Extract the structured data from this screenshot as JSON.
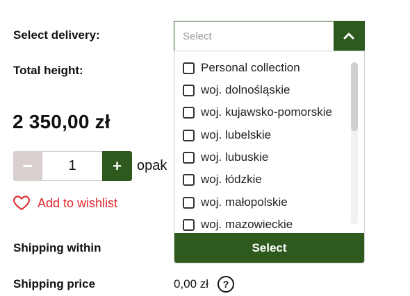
{
  "labels": {
    "select_delivery": "Select delivery:",
    "total_height": "Total height:",
    "shipping_within": "Shipping within",
    "shipping_price": "Shipping price"
  },
  "product": {
    "price": "2 350,00 zł"
  },
  "quantity": {
    "minus": "−",
    "value": "1",
    "plus": "+",
    "unit": "opak"
  },
  "wishlist": {
    "label": "Add to wishlist",
    "icon": "heart-icon",
    "color": "#e0252b"
  },
  "shipping": {
    "price": "0,00 zł",
    "help": "?"
  },
  "delivery_dropdown": {
    "placeholder": "Select",
    "toggle_icon": "chevron-up-icon",
    "options": [
      "Personal collection",
      "woj. dolnośląskie",
      "woj. kujawsko-pomorskie",
      "woj. lubelskie",
      "woj. lubuskie",
      "woj. łódzkie",
      "woj. małopolskie",
      "woj. mazowieckie"
    ],
    "select_button": "Select"
  },
  "colors": {
    "accent": "#2e5a1e",
    "wishlist": "#e0252b",
    "minus_bg": "#d9cfcf"
  }
}
